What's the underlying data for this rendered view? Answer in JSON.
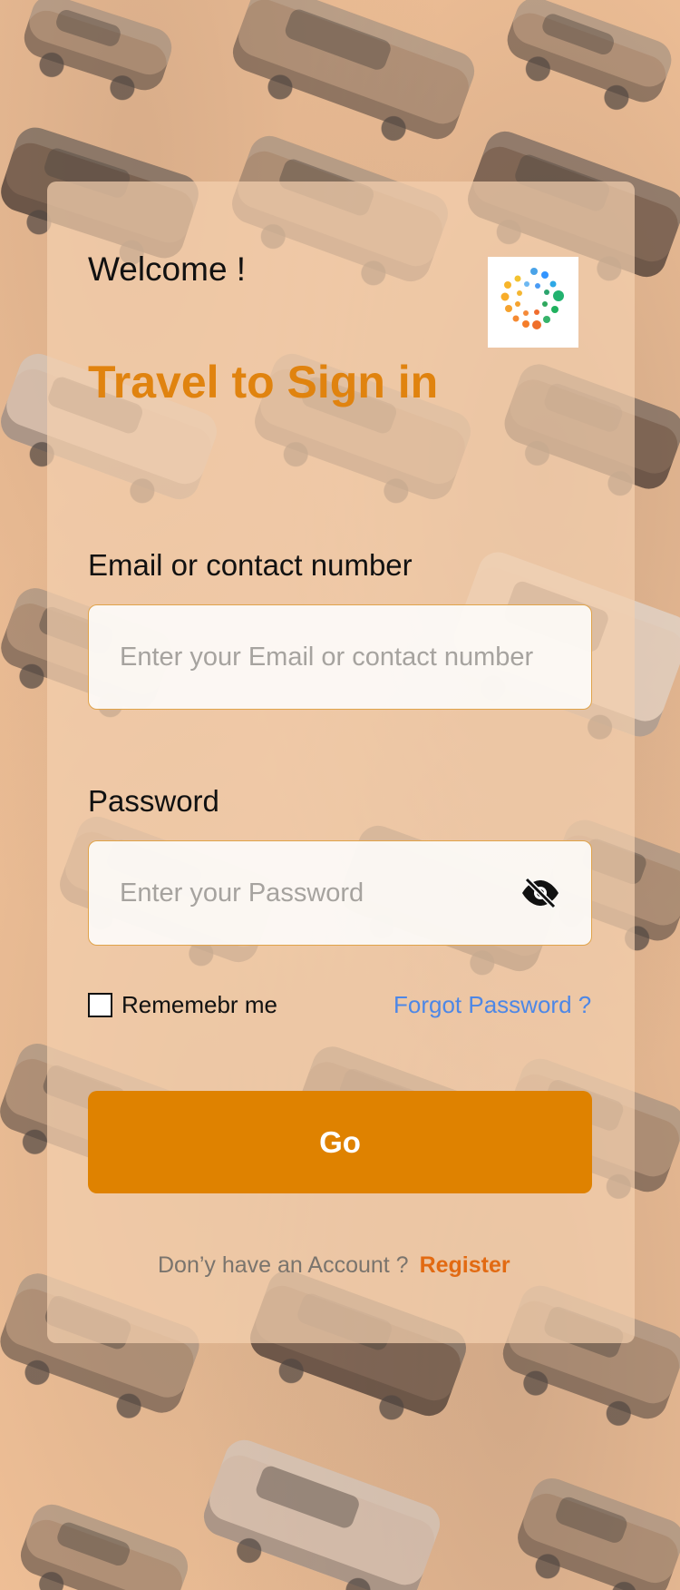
{
  "header": {
    "welcome": "Welcome !",
    "title": "Travel to Sign in"
  },
  "email": {
    "label": "Email or contact number",
    "placeholder": "Enter your Email or contact number"
  },
  "password": {
    "label": "Password",
    "placeholder": "Enter your Password",
    "toggle_icon": "eye-off-icon"
  },
  "options": {
    "remember_label": "Rememebr me",
    "forgot_label": "Forgot Password ?"
  },
  "actions": {
    "go_label": "Go"
  },
  "footer": {
    "account_prompt": "Don’y have an Account ?",
    "register_label": "Register"
  },
  "colors": {
    "accent": "#df8200",
    "title": "#e0830f",
    "link": "#4d87e6",
    "register": "#e26a12",
    "background": "#efbf96"
  },
  "icons": {
    "logo": "dotted-ring-logo",
    "password_toggle": "eye-off-icon"
  }
}
